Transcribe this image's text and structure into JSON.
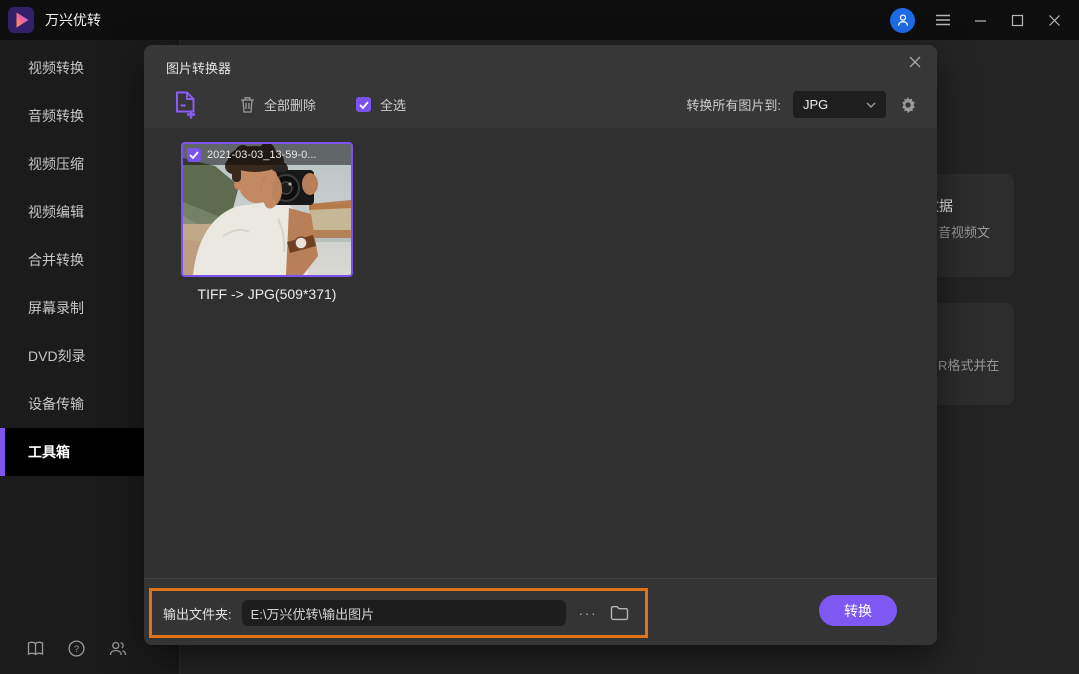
{
  "app": {
    "title": "万兴优转"
  },
  "titlebar": {
    "icons": {
      "avatar": "person-in-blue-circle",
      "menu": "hamburger",
      "minimize": "line",
      "maximize": "square",
      "close": "x"
    }
  },
  "sidebar": {
    "items": [
      {
        "label": "视频转换",
        "active": false
      },
      {
        "label": "音频转换",
        "active": false
      },
      {
        "label": "视频压缩",
        "active": false
      },
      {
        "label": "视频编辑",
        "active": false
      },
      {
        "label": "合并转换",
        "active": false
      },
      {
        "label": "屏幕录制",
        "active": false
      },
      {
        "label": "DVD刻录",
        "active": false
      },
      {
        "label": "设备传输",
        "active": false
      },
      {
        "label": "工具箱",
        "active": true
      }
    ],
    "bottom_icons": [
      "book-icon",
      "help-icon",
      "contacts-icon"
    ]
  },
  "background_cards": [
    {
      "title": "数据",
      "desc": "音视频文"
    },
    {
      "desc": "R格式并在"
    }
  ],
  "modal": {
    "title": "图片转换器",
    "toolbar": {
      "delete_all": "全部删除",
      "select_all": "全选",
      "convert_to_label": "转换所有图片到:",
      "format_value": "JPG"
    },
    "file": {
      "name": "2021-03-03_13-59-0...",
      "conversion": "TIFF -> JPG(509*371)",
      "selected": true
    },
    "footer": {
      "output_label": "输出文件夹:",
      "output_path": "E:\\万兴优转\\输出图片",
      "ellipsis": "···",
      "convert": "转换"
    }
  },
  "colors": {
    "accent_purple": "#7e58f2",
    "highlight_orange": "#e07318",
    "avatar_blue": "#1f6ce8",
    "thumb_border": "#7c52f0"
  }
}
